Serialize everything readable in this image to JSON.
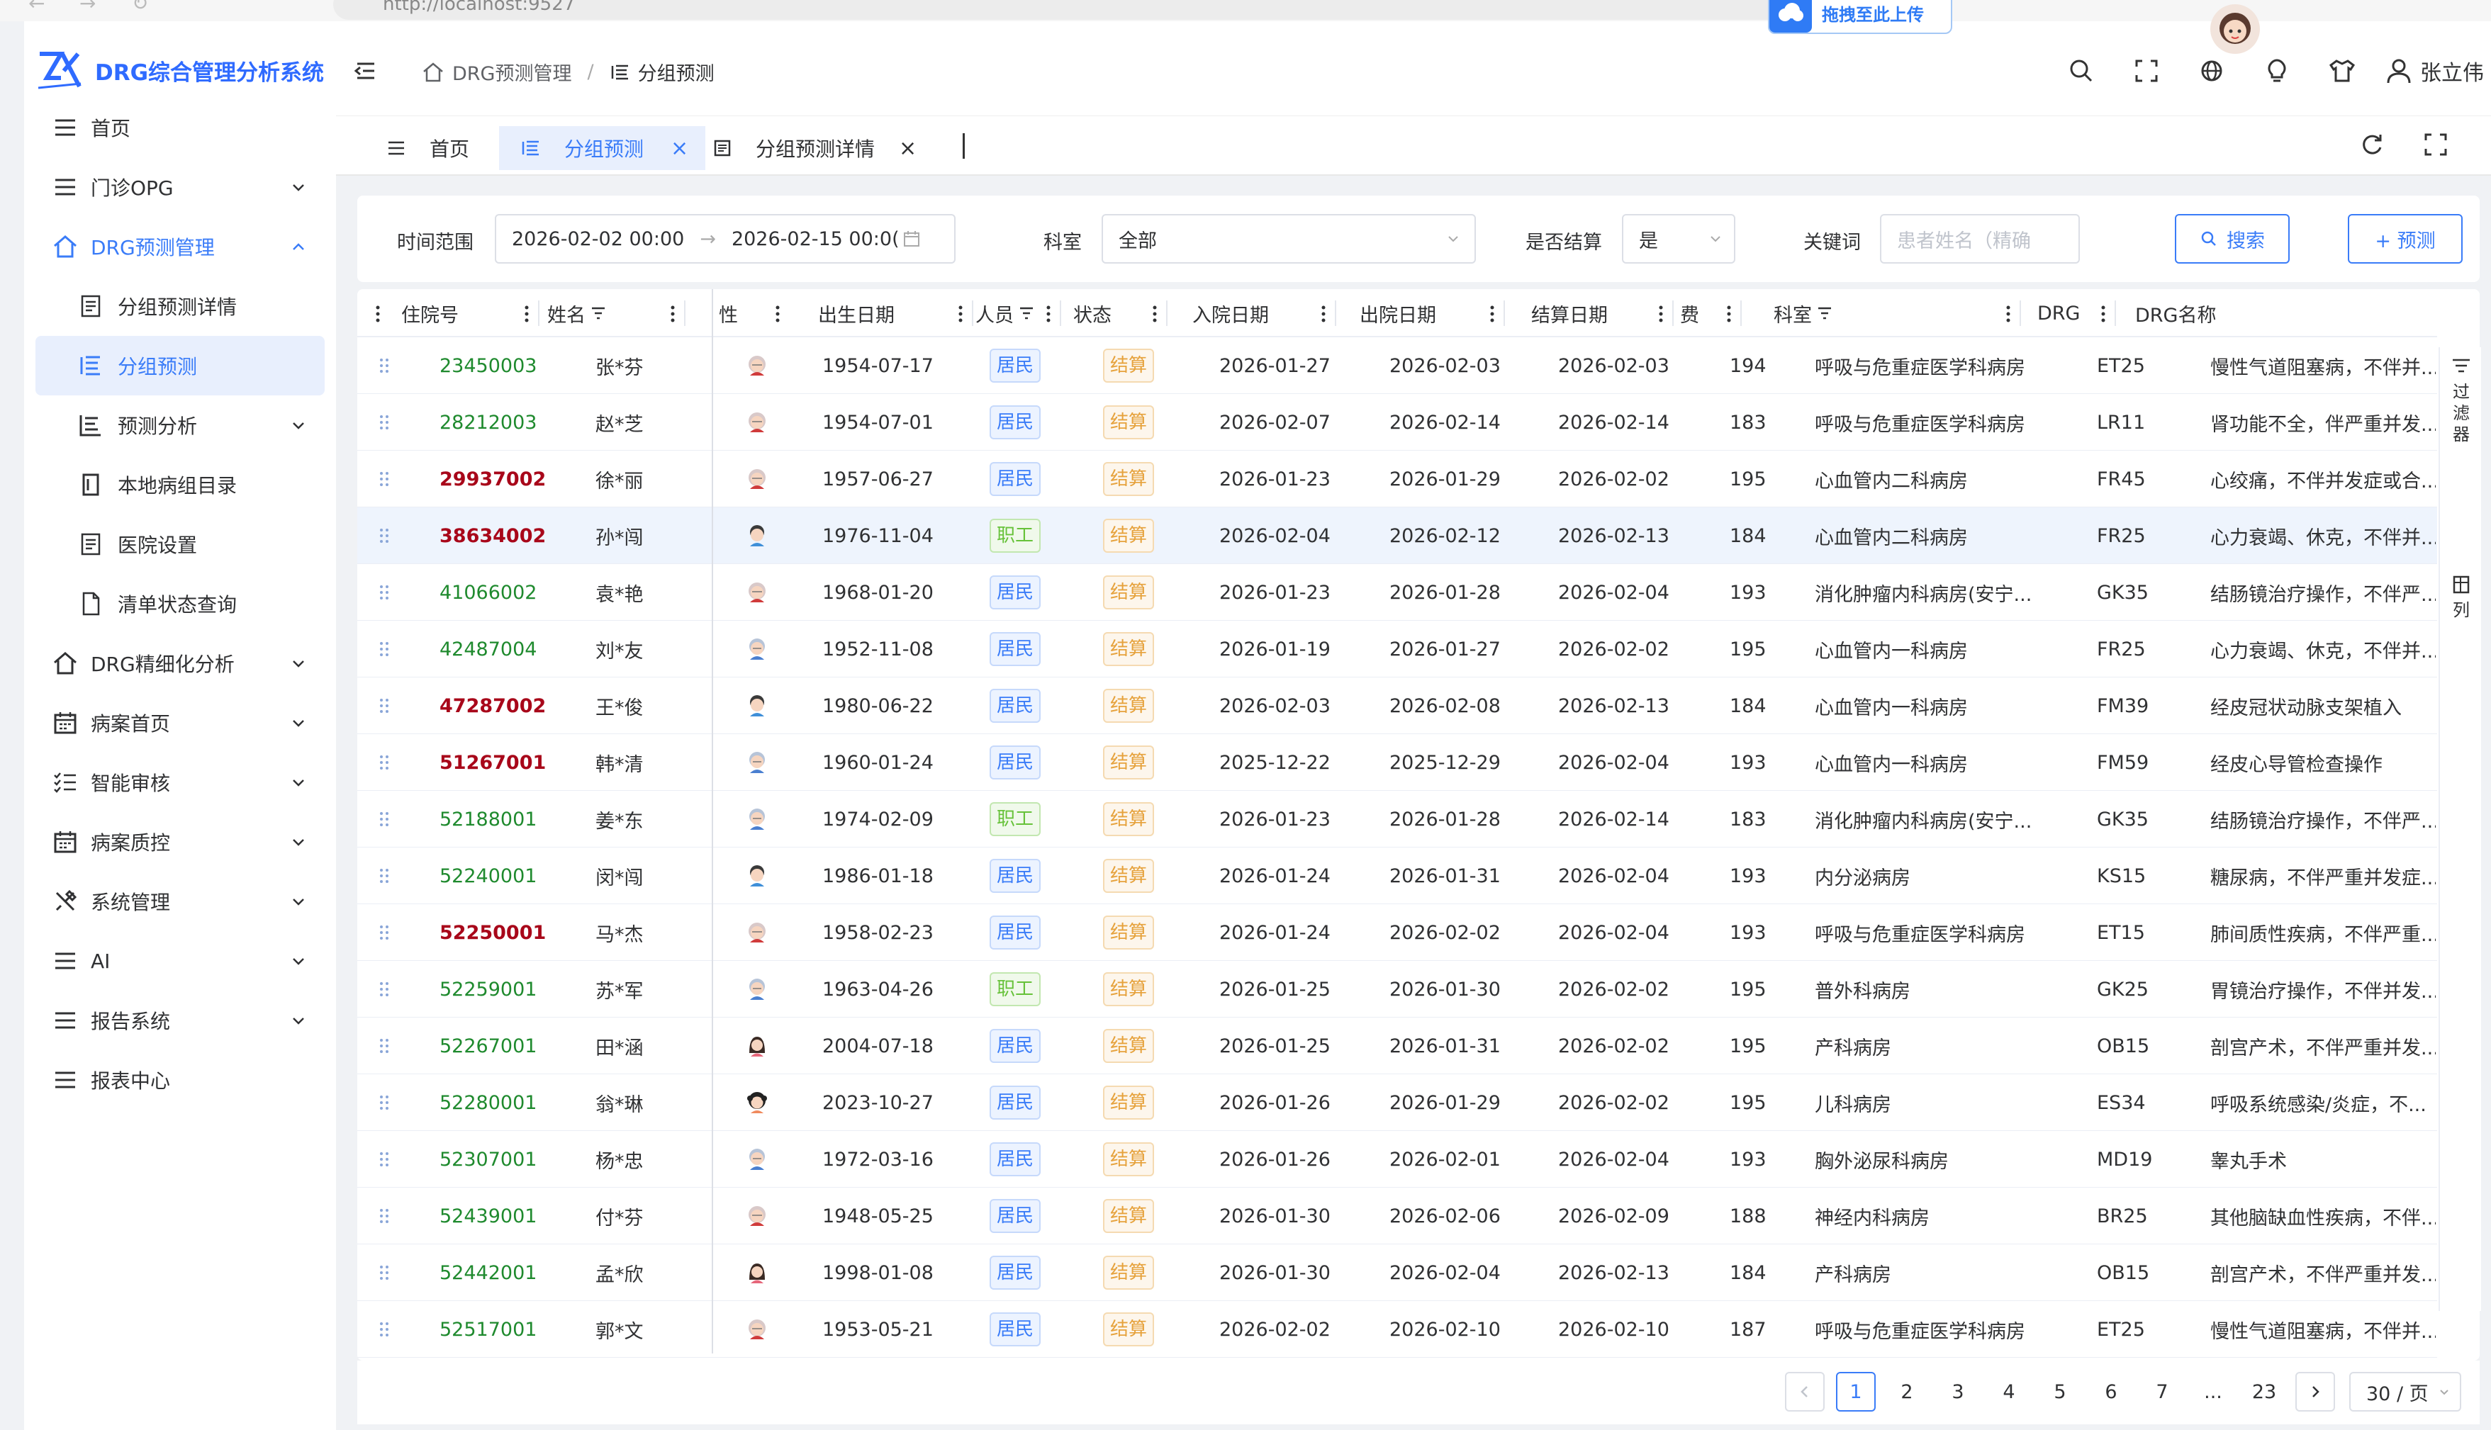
{
  "browser": {
    "url": "http://localhost:9527"
  },
  "upload_badge": {
    "label": "拖拽至此上传"
  },
  "app": {
    "title": "DRG综合管理分析系统"
  },
  "sidebar": {
    "items": [
      {
        "label": "首页",
        "icon": "menu-icon"
      },
      {
        "label": "门诊OPG",
        "icon": "menu-icon"
      },
      {
        "label": "DRG预测管理",
        "icon": "home-icon"
      },
      {
        "label": "分组预测详情",
        "icon": "document-icon"
      },
      {
        "label": "分组预测",
        "icon": "list-icon"
      },
      {
        "label": "预测分析",
        "icon": "chart-list-icon"
      },
      {
        "label": "本地病组目录",
        "icon": "catalog-icon"
      },
      {
        "label": "医院设置",
        "icon": "document-icon"
      },
      {
        "label": "清单状态查询",
        "icon": "file-icon"
      },
      {
        "label": "DRG精细化分析",
        "icon": "home-icon"
      },
      {
        "label": "病案首页",
        "icon": "calendar-icon"
      },
      {
        "label": "智能审核",
        "icon": "checklist-icon"
      },
      {
        "label": "病案质控",
        "icon": "calendar-icon"
      },
      {
        "label": "系统管理",
        "icon": "tools-icon"
      },
      {
        "label": "AI",
        "icon": "menu-icon"
      },
      {
        "label": "报告系统",
        "icon": "menu-icon"
      },
      {
        "label": "报表中心",
        "icon": "menu-icon"
      }
    ]
  },
  "header": {
    "breadcrumb": [
      "DRG预测管理",
      "分组预测"
    ],
    "user_name": "张立伟"
  },
  "tabs": [
    {
      "label": "首页"
    },
    {
      "label": "分组预测"
    },
    {
      "label": "分组预测详情"
    }
  ],
  "filter": {
    "time_label": "时间范围",
    "start": "2026-02-02 00:00",
    "end": "2026-02-15 00:0(",
    "dept_label": "科室",
    "dept_value": "全部",
    "settled_label": "是否结算",
    "settled_value": "是",
    "keyword_label": "关键词",
    "keyword_placeholder": "患者姓名（精确",
    "search_label": "搜索",
    "predict_label": "+ 预测"
  },
  "table": {
    "columns": [
      "住院号",
      "姓名",
      "性",
      "出生日期",
      "人员",
      "状态",
      "入院日期",
      "出院日期",
      "结算日期",
      "费",
      "科室",
      "DRG",
      "DRG名称"
    ],
    "rows": [
      {
        "id": "23450003",
        "id_color": "green",
        "name": "张*芬",
        "avatar": "elder-female",
        "birth": "1954-07-17",
        "type": "居民",
        "status": "结算",
        "admit": "2026-01-27",
        "discharge": "2026-02-03",
        "settle": "2026-02-03",
        "num": "194",
        "dept": "呼吸与危重症医学科病房",
        "drg": "ET25",
        "drg_name": "慢性气道阻塞病，不伴并..."
      },
      {
        "id": "28212003",
        "id_color": "green",
        "name": "赵*芝",
        "avatar": "elder-female",
        "birth": "1954-07-01",
        "type": "居民",
        "status": "结算",
        "admit": "2026-02-07",
        "discharge": "2026-02-14",
        "settle": "2026-02-14",
        "num": "183",
        "dept": "呼吸与危重症医学科病房",
        "drg": "LR11",
        "drg_name": "肾功能不全，伴严重并发..."
      },
      {
        "id": "29937002",
        "id_color": "red",
        "name": "徐*丽",
        "avatar": "elder-female",
        "birth": "1957-06-27",
        "type": "居民",
        "status": "结算",
        "admit": "2026-01-23",
        "discharge": "2026-01-29",
        "settle": "2026-02-02",
        "num": "195",
        "dept": "心血管内二科病房",
        "drg": "FR45",
        "drg_name": "心绞痛，不伴并发症或合..."
      },
      {
        "id": "38634002",
        "id_color": "red",
        "name": "孙*闯",
        "avatar": "adult-male",
        "birth": "1976-11-04",
        "type": "职工",
        "status": "结算",
        "admit": "2026-02-04",
        "discharge": "2026-02-12",
        "settle": "2026-02-13",
        "num": "184",
        "dept": "心血管内二科病房",
        "drg": "FR25",
        "drg_name": "心力衰竭、休克，不伴并..."
      },
      {
        "id": "41066002",
        "id_color": "green",
        "name": "袁*艳",
        "avatar": "elder-female",
        "birth": "1968-01-20",
        "type": "居民",
        "status": "结算",
        "admit": "2026-01-23",
        "discharge": "2026-01-28",
        "settle": "2026-02-04",
        "num": "193",
        "dept": "消化肿瘤内科病房(安宁...",
        "drg": "GK35",
        "drg_name": "结肠镜治疗操作，不伴严..."
      },
      {
        "id": "42487004",
        "id_color": "green",
        "name": "刘*友",
        "avatar": "elder-male",
        "birth": "1952-11-08",
        "type": "居民",
        "status": "结算",
        "admit": "2026-01-19",
        "discharge": "2026-01-27",
        "settle": "2026-02-02",
        "num": "195",
        "dept": "心血管内一科病房",
        "drg": "FR25",
        "drg_name": "心力衰竭、休克，不伴并..."
      },
      {
        "id": "47287002",
        "id_color": "red",
        "name": "王*俊",
        "avatar": "adult-male",
        "birth": "1980-06-22",
        "type": "居民",
        "status": "结算",
        "admit": "2026-02-03",
        "discharge": "2026-02-08",
        "settle": "2026-02-13",
        "num": "184",
        "dept": "心血管内一科病房",
        "drg": "FM39",
        "drg_name": "经皮冠状动脉支架植入"
      },
      {
        "id": "51267001",
        "id_color": "red",
        "name": "韩*清",
        "avatar": "elder-male",
        "birth": "1960-01-24",
        "type": "居民",
        "status": "结算",
        "admit": "2025-12-22",
        "discharge": "2025-12-29",
        "settle": "2026-02-04",
        "num": "193",
        "dept": "心血管内一科病房",
        "drg": "FM59",
        "drg_name": "经皮心导管检查操作"
      },
      {
        "id": "52188001",
        "id_color": "green",
        "name": "姜*东",
        "avatar": "elder-male",
        "birth": "1974-02-09",
        "type": "职工",
        "status": "结算",
        "admit": "2026-01-23",
        "discharge": "2026-01-28",
        "settle": "2026-02-14",
        "num": "183",
        "dept": "消化肿瘤内科病房(安宁...",
        "drg": "GK35",
        "drg_name": "结肠镜治疗操作，不伴严..."
      },
      {
        "id": "52240001",
        "id_color": "green",
        "name": "闵*闯",
        "avatar": "adult-male",
        "birth": "1986-01-18",
        "type": "居民",
        "status": "结算",
        "admit": "2026-01-24",
        "discharge": "2026-01-31",
        "settle": "2026-02-04",
        "num": "193",
        "dept": "内分泌病房",
        "drg": "KS15",
        "drg_name": "糖尿病，不伴严重并发症..."
      },
      {
        "id": "52250001",
        "id_color": "red",
        "name": "马*杰",
        "avatar": "elder-female",
        "birth": "1958-02-23",
        "type": "居民",
        "status": "结算",
        "admit": "2026-01-24",
        "discharge": "2026-02-02",
        "settle": "2026-02-04",
        "num": "193",
        "dept": "呼吸与危重症医学科病房",
        "drg": "ET15",
        "drg_name": "肺间质性疾病，不伴严重..."
      },
      {
        "id": "52259001",
        "id_color": "green",
        "name": "苏*军",
        "avatar": "elder-male",
        "birth": "1963-04-26",
        "type": "职工",
        "status": "结算",
        "admit": "2026-01-25",
        "discharge": "2026-01-30",
        "settle": "2026-02-02",
        "num": "195",
        "dept": "普外科病房",
        "drg": "GK25",
        "drg_name": "胃镜治疗操作，不伴并发..."
      },
      {
        "id": "52267001",
        "id_color": "green",
        "name": "田*涵",
        "avatar": "young-female",
        "birth": "2004-07-18",
        "type": "居民",
        "status": "结算",
        "admit": "2026-01-25",
        "discharge": "2026-01-31",
        "settle": "2026-02-02",
        "num": "195",
        "dept": "产科病房",
        "drg": "OB15",
        "drg_name": "剖宫产术，不伴严重并发..."
      },
      {
        "id": "52280001",
        "id_color": "green",
        "name": "翁*琳",
        "avatar": "child",
        "birth": "2023-10-27",
        "type": "居民",
        "status": "结算",
        "admit": "2026-01-26",
        "discharge": "2026-01-29",
        "settle": "2026-02-02",
        "num": "195",
        "dept": "儿科病房",
        "drg": "ES34",
        "drg_name": "呼吸系统感染/炎症，不..."
      },
      {
        "id": "52307001",
        "id_color": "green",
        "name": "杨*忠",
        "avatar": "elder-male",
        "birth": "1972-03-16",
        "type": "居民",
        "status": "结算",
        "admit": "2026-01-26",
        "discharge": "2026-02-01",
        "settle": "2026-02-04",
        "num": "193",
        "dept": "胸外泌尿科病房",
        "drg": "MD19",
        "drg_name": "睾丸手术"
      },
      {
        "id": "52439001",
        "id_color": "green",
        "name": "付*芬",
        "avatar": "elder-female",
        "birth": "1948-05-25",
        "type": "居民",
        "status": "结算",
        "admit": "2026-01-30",
        "discharge": "2026-02-06",
        "settle": "2026-02-09",
        "num": "188",
        "dept": "神经内科病房",
        "drg": "BR25",
        "drg_name": "其他脑缺血性疾病，不伴..."
      },
      {
        "id": "52442001",
        "id_color": "green",
        "name": "孟*欣",
        "avatar": "young-female",
        "birth": "1998-01-08",
        "type": "居民",
        "status": "结算",
        "admit": "2026-01-30",
        "discharge": "2026-02-04",
        "settle": "2026-02-13",
        "num": "184",
        "dept": "产科病房",
        "drg": "OB15",
        "drg_name": "剖宫产术，不伴严重并发..."
      },
      {
        "id": "52517001",
        "id_color": "green",
        "name": "郭*文",
        "avatar": "elder-female",
        "birth": "1953-05-21",
        "type": "居民",
        "status": "结算",
        "admit": "2026-02-02",
        "discharge": "2026-02-10",
        "settle": "2026-02-10",
        "num": "187",
        "dept": "呼吸与危重症医学科病房",
        "drg": "ET25",
        "drg_name": "慢性气道阻塞病，不伴并..."
      }
    ],
    "highlighted_row": 3
  },
  "side_panel": {
    "filter_label": "过滤器",
    "columns_label": "列"
  },
  "pagination": {
    "pages": [
      "1",
      "2",
      "3",
      "4",
      "5",
      "6",
      "7",
      "...",
      "23"
    ],
    "current": "1",
    "page_size": "30 / 页"
  },
  "colors": {
    "accent": "#3a7cf8",
    "green_id": "#1f8a2e",
    "red_id": "#a8071a",
    "active_bg": "#e8effd"
  }
}
